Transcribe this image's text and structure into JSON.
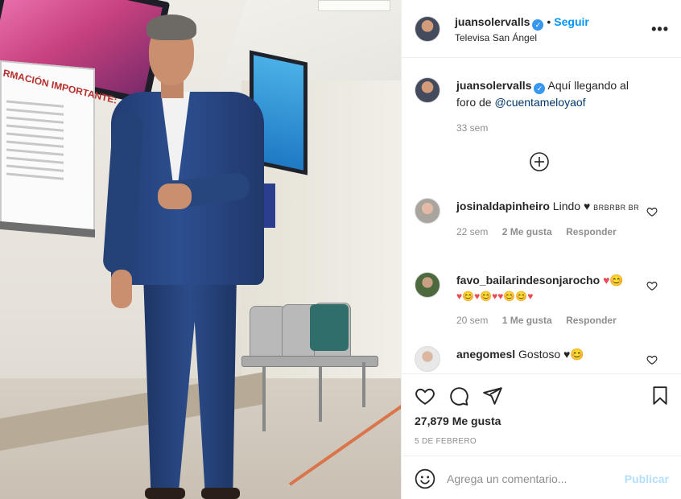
{
  "post": {
    "username": "juansolervalls",
    "follow_label": "Seguir",
    "dot": "•",
    "location": "Televisa San Ángel",
    "caption": "Aquí llegando al foro de",
    "caption_mention": "@cuentameloyaof",
    "caption_time": "33 sem",
    "likes": "27,879 Me gusta",
    "date": "5 DE FEBRERO"
  },
  "photo": {
    "notice_title": "RMACIÓN IMPORTANTE:"
  },
  "comments": [
    {
      "username": "josinaldapinheiro",
      "text": "Lindo ♥",
      "small": "BRBRBR BR",
      "time": "22 sem",
      "likes": "2 Me gusta",
      "reply": "Responder"
    },
    {
      "username": "favo_bailarindesonjarocho",
      "text": "♥😊",
      "line2": "♥😊♥😊♥♥😊😊♥",
      "time": "20 sem",
      "likes": "1 Me gusta",
      "reply": "Responder"
    },
    {
      "username": "anegomesl",
      "text": "Gostoso ♥😊"
    }
  ],
  "add_comment": {
    "placeholder": "Agrega un comentario...",
    "publish": "Publicar"
  },
  "icons": [
    "heart-icon",
    "comment-icon",
    "share-icon",
    "bookmark-icon",
    "emoji-icon",
    "more-icon",
    "plus-circle-icon",
    "verified-icon"
  ],
  "colors": {
    "accent": "#0095f6",
    "publish_disabled": "#b2dffc",
    "muted": "#8e8e8e",
    "heart_red": "#ed4956"
  }
}
